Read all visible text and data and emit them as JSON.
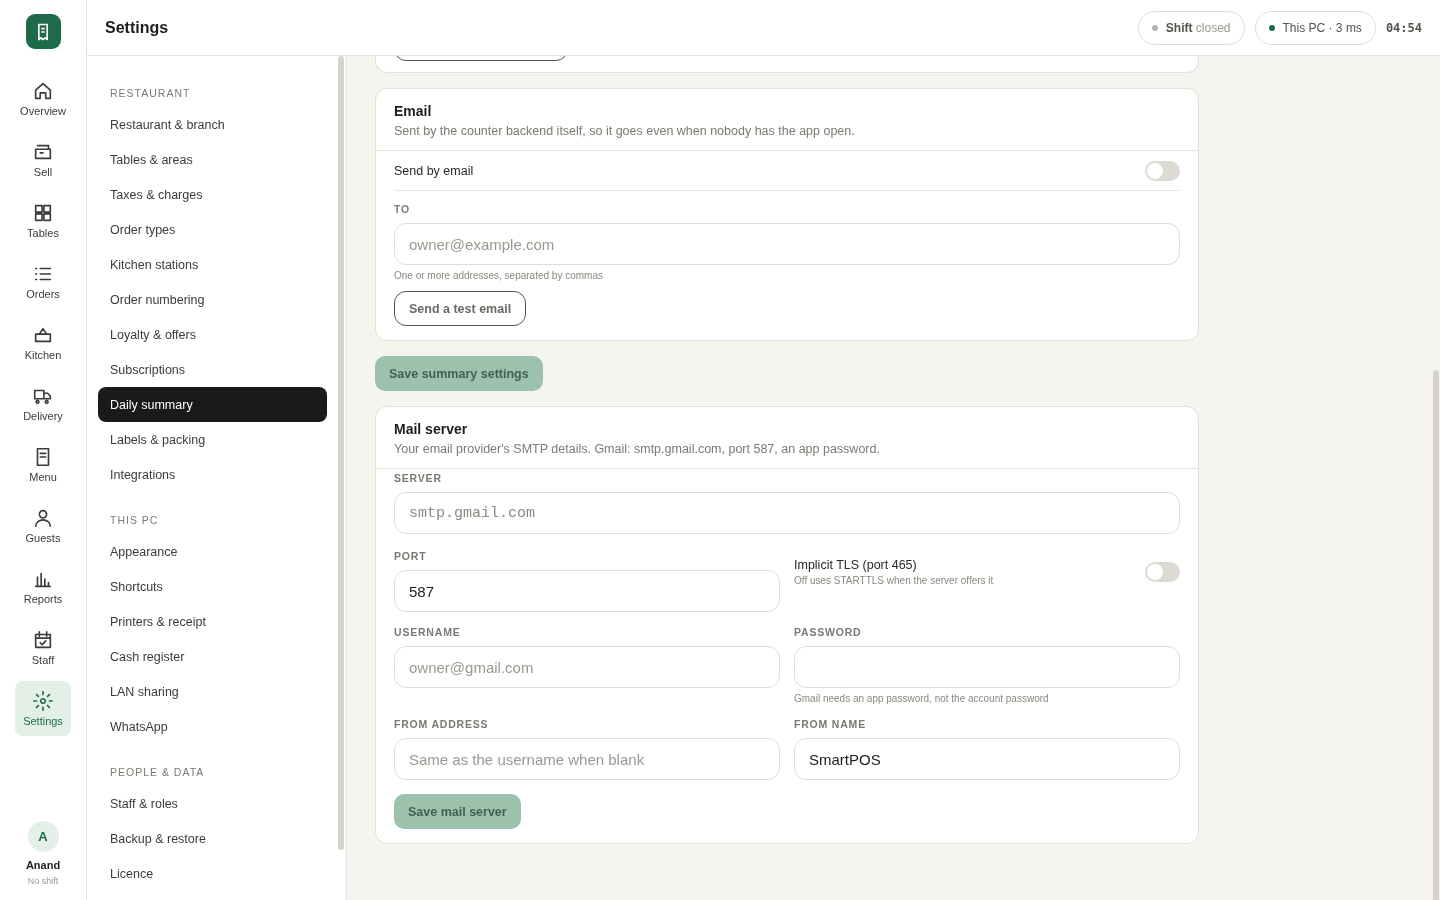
{
  "rail": {
    "items": [
      {
        "label": "Overview",
        "selected": false
      },
      {
        "label": "Sell",
        "selected": false
      },
      {
        "label": "Tables",
        "selected": false
      },
      {
        "label": "Orders",
        "selected": false
      },
      {
        "label": "Kitchen",
        "selected": false
      },
      {
        "label": "Delivery",
        "selected": false
      },
      {
        "label": "Menu",
        "selected": false
      },
      {
        "label": "Guests",
        "selected": false
      },
      {
        "label": "Reports",
        "selected": false
      },
      {
        "label": "Staff",
        "selected": false
      },
      {
        "label": "Settings",
        "selected": true
      }
    ],
    "user": {
      "initial": "A",
      "name": "Anand",
      "status": "No shift"
    }
  },
  "header": {
    "title": "Settings",
    "shift": {
      "label": "Shift",
      "state": "closed",
      "color": "#b5b3aa"
    },
    "connection": {
      "label": "This PC · 3 ms",
      "color": "#1e6b4a"
    },
    "time": "04:54"
  },
  "nav": {
    "sections": [
      {
        "title": "RESTAURANT",
        "items": [
          {
            "label": "Restaurant & branch",
            "selected": false
          },
          {
            "label": "Tables & areas",
            "selected": false
          },
          {
            "label": "Taxes & charges",
            "selected": false
          },
          {
            "label": "Order types",
            "selected": false
          },
          {
            "label": "Kitchen stations",
            "selected": false
          },
          {
            "label": "Order numbering",
            "selected": false
          },
          {
            "label": "Loyalty & offers",
            "selected": false
          },
          {
            "label": "Subscriptions",
            "selected": false
          },
          {
            "label": "Daily summary",
            "selected": true
          },
          {
            "label": "Labels & packing",
            "selected": false
          },
          {
            "label": "Integrations",
            "selected": false
          }
        ]
      },
      {
        "title": "THIS PC",
        "items": [
          {
            "label": "Appearance",
            "selected": false
          },
          {
            "label": "Shortcuts",
            "selected": false
          },
          {
            "label": "Printers & receipt",
            "selected": false
          },
          {
            "label": "Cash register",
            "selected": false
          },
          {
            "label": "LAN sharing",
            "selected": false
          },
          {
            "label": "WhatsApp",
            "selected": false
          }
        ]
      },
      {
        "title": "PEOPLE & DATA",
        "items": [
          {
            "label": "Staff & roles",
            "selected": false
          },
          {
            "label": "Backup & restore",
            "selected": false
          },
          {
            "label": "Licence",
            "selected": false
          }
        ]
      }
    ]
  },
  "email_card": {
    "title": "Email",
    "description": "Sent by the counter backend itself, so it goes even when nobody has the app open.",
    "toggle": {
      "label": "Send by email",
      "on": false
    },
    "to": {
      "label": "TO",
      "placeholder": "owner@example.com",
      "hint": "One or more addresses, separated by commas"
    },
    "test_button": "Send a test email"
  },
  "save_summary": {
    "label": "Save summary settings",
    "disabled": true
  },
  "mail_card": {
    "title": "Mail server",
    "description": "Your email provider's SMTP details. Gmail: smtp.gmail.com, port 587, an app password.",
    "server": {
      "label": "SERVER",
      "placeholder": "smtp.gmail.com"
    },
    "port": {
      "label": "PORT",
      "value": "587"
    },
    "tls": {
      "label": "Implicit TLS (port 465)",
      "hint": "Off uses STARTTLS when the server offers it",
      "on": false
    },
    "username": {
      "label": "USERNAME",
      "placeholder": "owner@gmail.com"
    },
    "password": {
      "label": "PASSWORD",
      "hint": "Gmail needs an app password, not the account password"
    },
    "from_address": {
      "label": "FROM ADDRESS",
      "placeholder": "Same as the username when blank"
    },
    "from_name": {
      "label": "FROM NAME",
      "value": "SmartPOS"
    },
    "save": {
      "label": "Save mail server",
      "disabled": true
    }
  }
}
